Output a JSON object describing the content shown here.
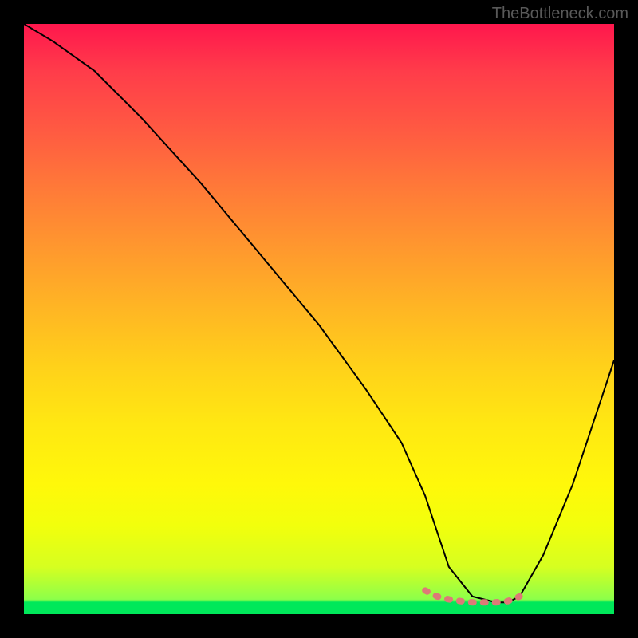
{
  "watermark": "TheBottleneck.com",
  "chart_data": {
    "type": "line",
    "title": "",
    "xlabel": "",
    "ylabel": "",
    "xlim": [
      0,
      100
    ],
    "ylim": [
      0,
      100
    ],
    "series": [
      {
        "name": "bottleneck-curve",
        "color": "#000000",
        "x": [
          0,
          5,
          12,
          20,
          30,
          40,
          50,
          58,
          64,
          68,
          70,
          72,
          76,
          80,
          82,
          84,
          88,
          93,
          100
        ],
        "y": [
          100,
          97,
          92,
          84,
          73,
          61,
          49,
          38,
          29,
          20,
          14,
          8,
          3,
          2,
          2,
          3,
          10,
          22,
          43
        ]
      },
      {
        "name": "optimal-marker",
        "color": "#e06666",
        "x": [
          68,
          70,
          72,
          74,
          76,
          78,
          80,
          82,
          84
        ],
        "y": [
          4,
          3,
          2.5,
          2.2,
          2,
          2,
          2,
          2.2,
          3
        ]
      }
    ],
    "gradient_stops": [
      {
        "pos": 0,
        "color": "#ff174d"
      },
      {
        "pos": 50,
        "color": "#ffc81e"
      },
      {
        "pos": 85,
        "color": "#f2ff0c"
      },
      {
        "pos": 98,
        "color": "#00e85a"
      },
      {
        "pos": 100,
        "color": "#00e85a"
      }
    ]
  }
}
